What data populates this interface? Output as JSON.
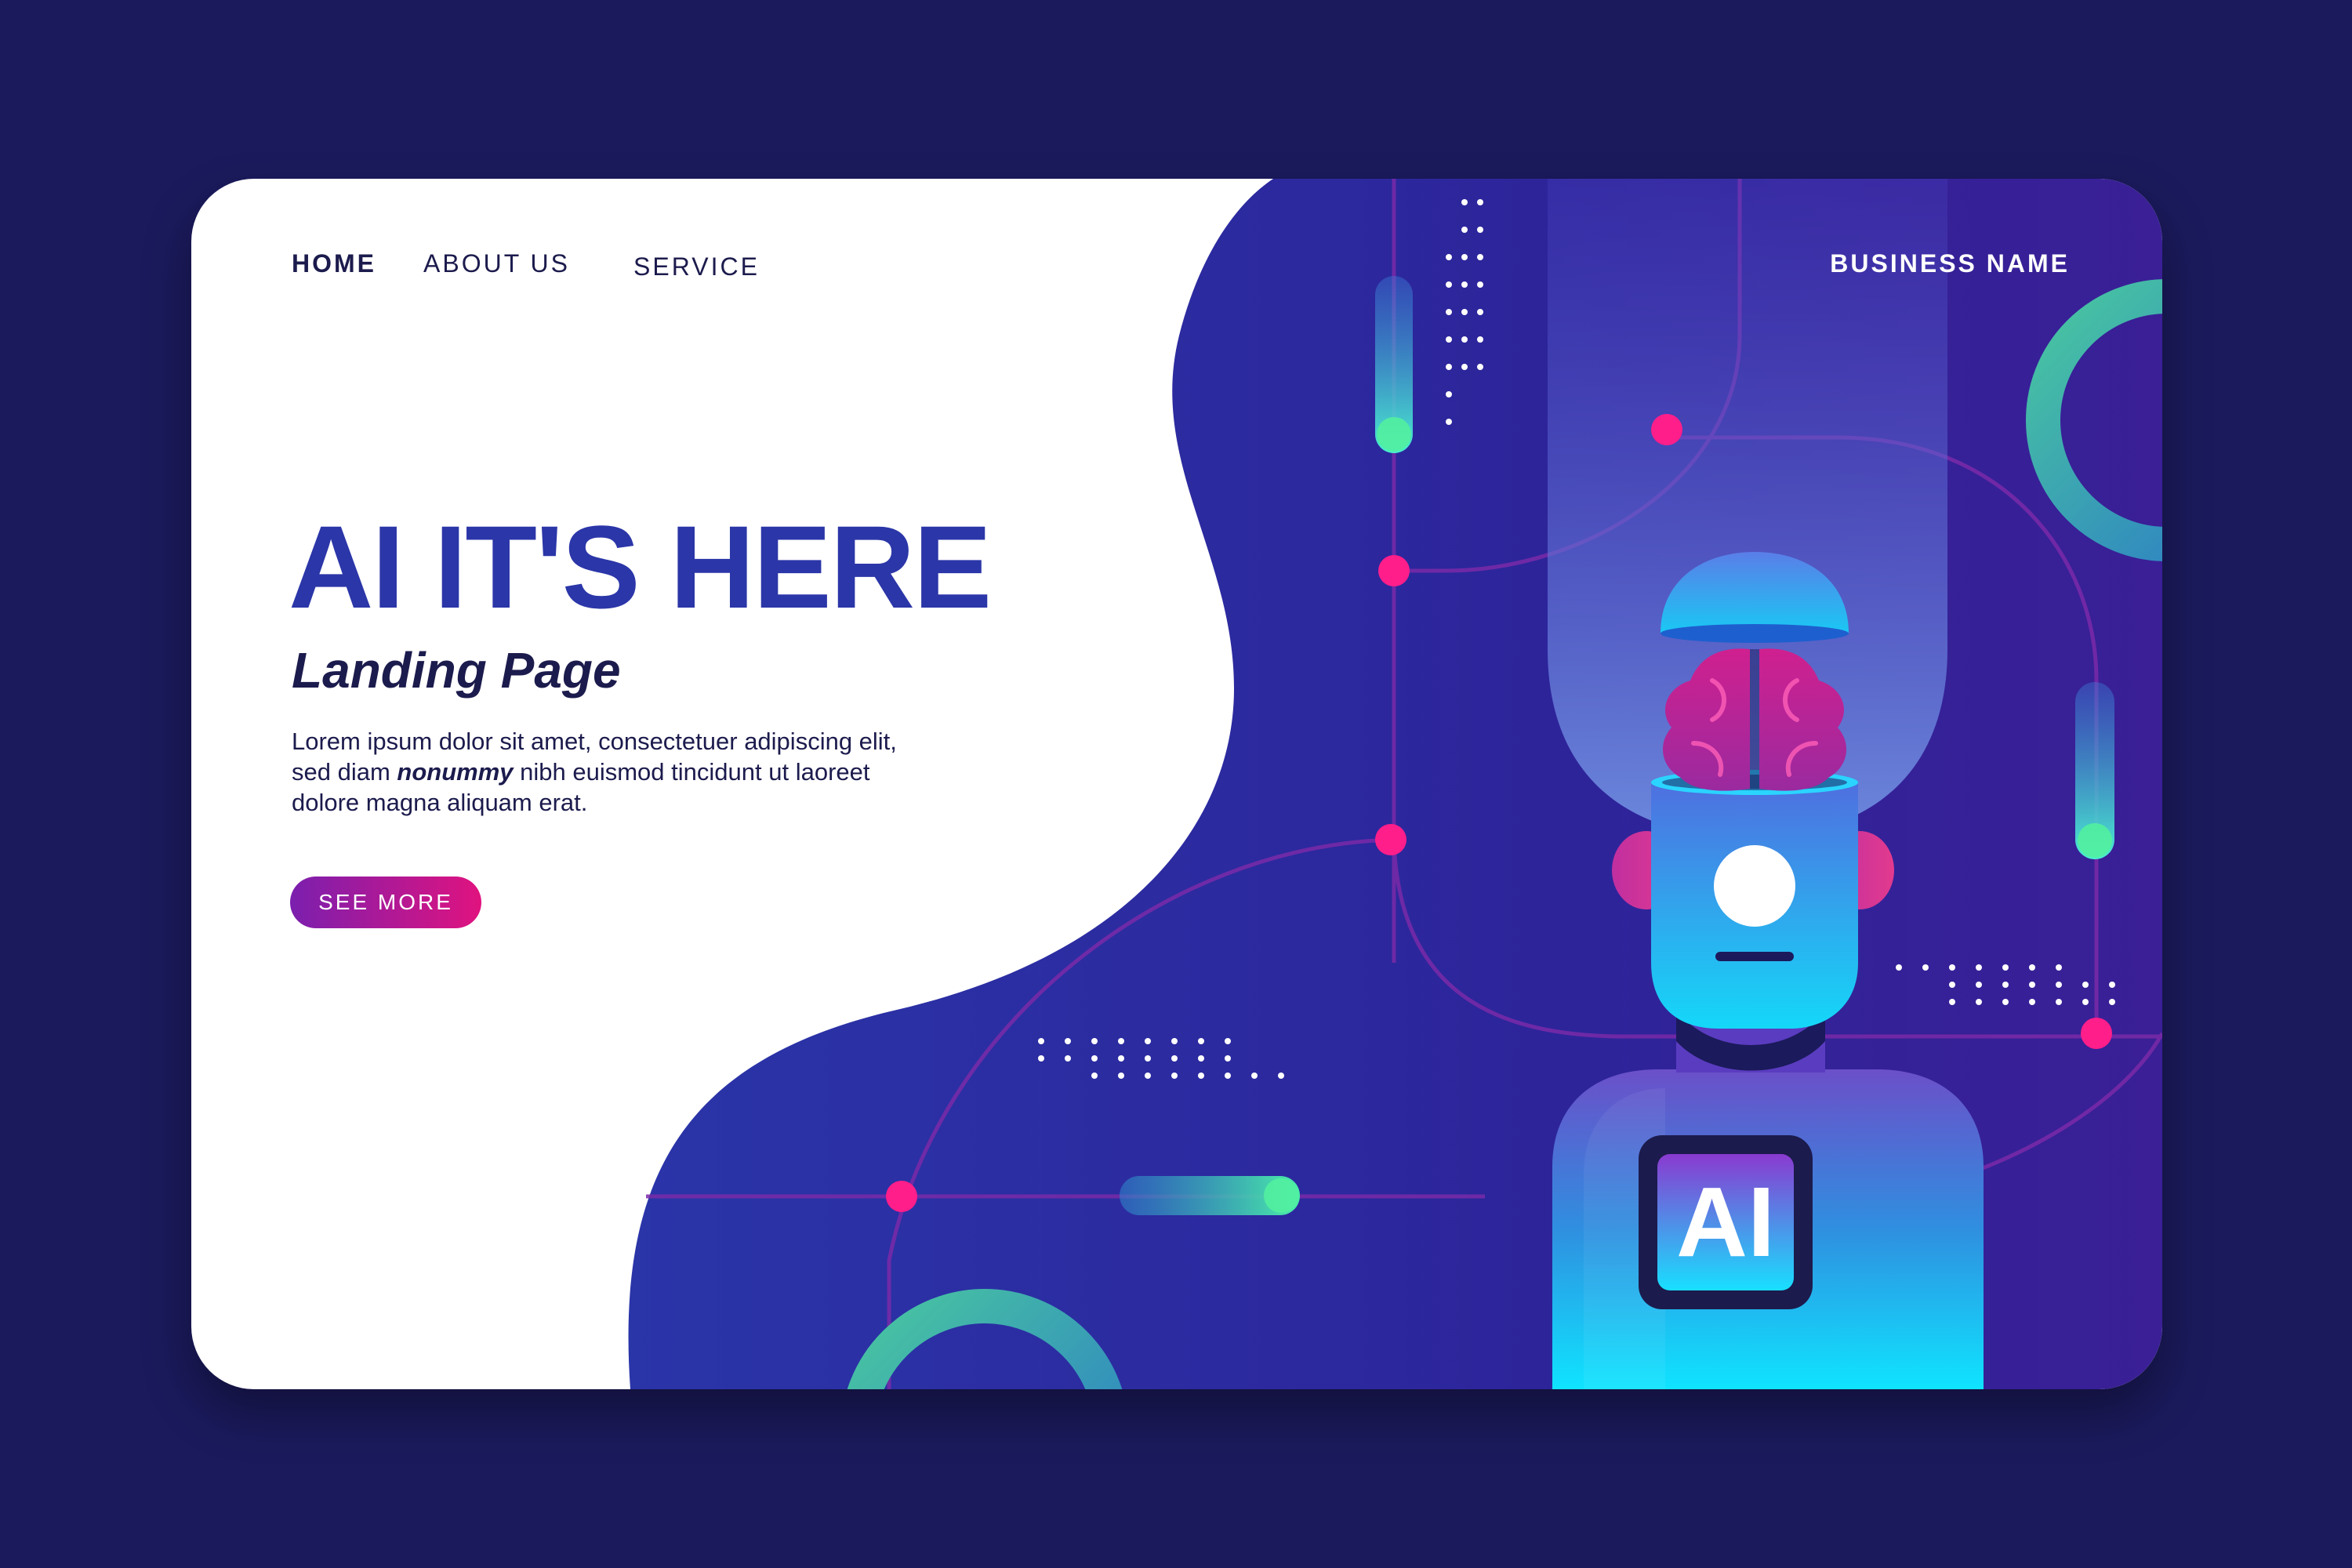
{
  "nav": {
    "items": [
      {
        "label": "HOME"
      },
      {
        "label": "ABOUT US"
      },
      {
        "label": "SERVICE"
      }
    ],
    "brand": "BUSINESS NAME"
  },
  "hero": {
    "title": "AI IT'S HERE",
    "subtitle": "Landing Page",
    "body_before": "Lorem ipsum dolor sit amet, consectetuer adipiscing elit, sed diam ",
    "body_emphasis": "nonummy",
    "body_after": " nibh euismod tincidunt ut laoreet dolore magna aliquam erat.",
    "cta_label": "SEE MORE"
  },
  "illustration": {
    "chest_badge": "AI",
    "icons": [
      "robot-illustration",
      "brain-icon",
      "circuit-lines"
    ]
  },
  "colors": {
    "background": "#1b1a5c",
    "headline": "#2b36a8",
    "text": "#1c1b4d",
    "cta_start": "#7b1fae",
    "cta_end": "#e0137f",
    "node_pink": "#ff1e8a",
    "accent_cyan": "#12e4ff"
  }
}
